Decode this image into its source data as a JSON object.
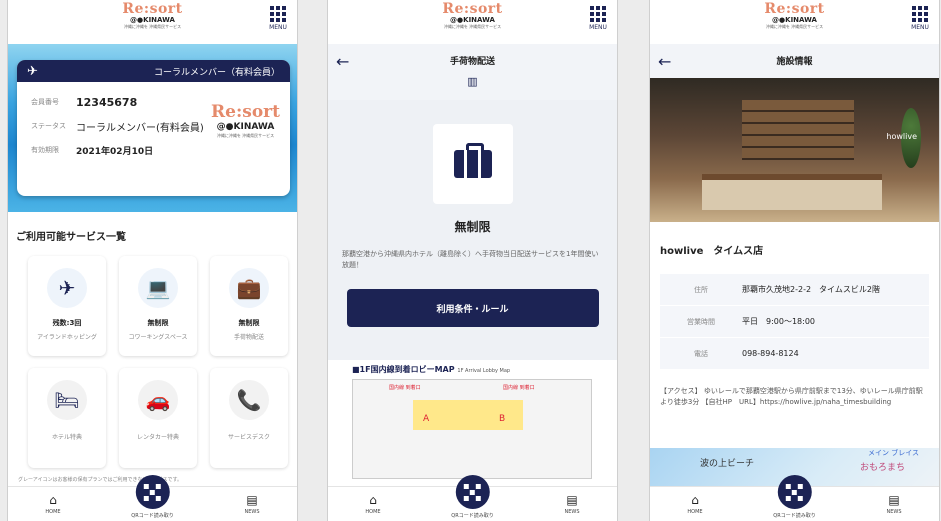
{
  "header": {
    "logo_line1": "Re:sort",
    "logo_line2": "@●KINAWA",
    "logo_line3": "沖縄に沖縄を 沖縄県民サービス",
    "menu_label": "MENU"
  },
  "bottom_nav": {
    "home": "HOME",
    "qr": "QRコード読み取り",
    "news": "NEWS"
  },
  "screen1": {
    "card": {
      "member_type": "コーラルメンバー（有料会員）",
      "rows": [
        {
          "key": "会員番号",
          "value": "12345678"
        },
        {
          "key": "ステータス",
          "value": "コーラルメンバー(有料会員)"
        },
        {
          "key": "有効期限",
          "value": "2021年02月10日"
        }
      ]
    },
    "services_title": "ご利用可能サービス一覧",
    "tiles": [
      {
        "label": "残数:3回",
        "sub": "アイランドホッピング",
        "icon": "airplane-icon"
      },
      {
        "label": "無制限",
        "sub": "コワーキングスペース",
        "icon": "laptop-icon"
      },
      {
        "label": "無制限",
        "sub": "手荷物配送",
        "icon": "suitcase-icon"
      },
      {
        "label": "",
        "sub": "ホテル特典",
        "icon": "bed-icon"
      },
      {
        "label": "",
        "sub": "レンタカー特典",
        "icon": "car-icon"
      },
      {
        "label": "",
        "sub": "サービスデスク",
        "icon": "phone-icon"
      }
    ],
    "note": "グレーアイコンはお客様の保有プランではご利用できないサービスです。"
  },
  "screen2": {
    "title": "手荷物配送",
    "unlimited": "無制限",
    "description": "那覇空港から沖縄県内ホテル（離島除く）へ手荷物当日配送サービスを1年間使い放題！",
    "button": "利用条件・ルール",
    "map_title": "■1F国内線到着ロビーMAP",
    "map_sub": "1F Arrival Lobby Map",
    "map_labels": [
      "国内線 到着口",
      "国内線 到着口",
      "A",
      "B"
    ]
  },
  "screen3": {
    "title": "施設情報",
    "facility_name": "howlive　タイムス店",
    "photo_sign": "howlive",
    "info": [
      {
        "key": "住所",
        "value": "那覇市久茂地2-2-2　タイムスビル2階"
      },
      {
        "key": "営業時間",
        "value": "平日　9:00〜18:00"
      },
      {
        "key": "電話",
        "value": "098-894-8124"
      }
    ],
    "access": "【アクセス】 ゆいレールで那覇空港駅から県庁前駅まで13分、ゆいレール県庁前駅より徒歩3分 【自社HP　URL】https://howlive.jp/naha_timesbuilding",
    "map_text1": "波の上ビーチ",
    "map_text2": "おもろまち",
    "map_text3": "メイン ブレイス"
  }
}
